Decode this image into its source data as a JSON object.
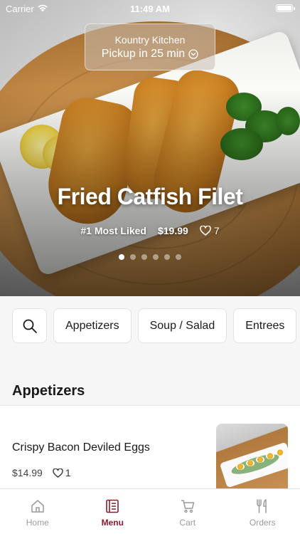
{
  "status_bar": {
    "carrier": "Carrier",
    "time": "11:49 AM",
    "battery_level": 1.0
  },
  "pickup": {
    "restaurant": "Kountry Kitchen",
    "pickup_time": "Pickup in 25 min",
    "icon": "chevron-down-circle-icon"
  },
  "featured": {
    "title": "Fried Catfish Filet",
    "badge": "#1 Most Liked",
    "price": "$19.99",
    "likes": "7",
    "slide_count": 6,
    "active_slide": 1
  },
  "categories": [
    {
      "label": "",
      "icon": "search-icon"
    },
    {
      "label": "Appetizers"
    },
    {
      "label": "Soup / Salad"
    },
    {
      "label": "Entrees"
    }
  ],
  "section": {
    "title": "Appetizers"
  },
  "items": [
    {
      "name": "Crispy Bacon Deviled Eggs",
      "price": "$14.99",
      "likes": "1"
    }
  ],
  "tabbar": {
    "active_color": "#8e1b2f",
    "tabs": [
      {
        "label": "Home",
        "icon": "home-icon"
      },
      {
        "label": "Menu",
        "icon": "menu-icon",
        "active": true
      },
      {
        "label": "Cart",
        "icon": "cart-icon"
      },
      {
        "label": "Orders",
        "icon": "fork-knife-icon"
      }
    ]
  }
}
